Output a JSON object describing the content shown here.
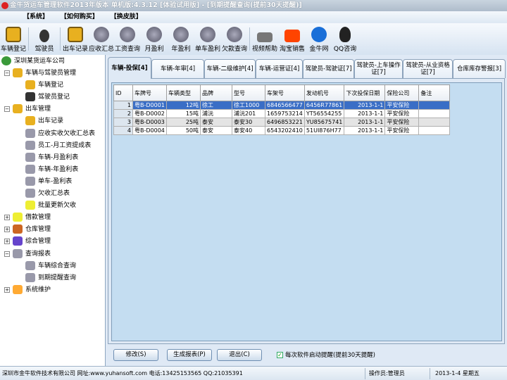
{
  "title": "金牛货运车管理软件2013年版本 单机版:4.3.12 [体验试用版] - [到期提醒查询(提前30天提醒)]",
  "menu": [
    "【系统】",
    "【如何购买】",
    "【换皮肤】"
  ],
  "toolbar": [
    "车辆登记",
    "驾驶员",
    "出车记录",
    "应收汇总",
    "工资查询",
    "月盈利",
    "年盈利",
    "单车盈利",
    "欠款查询",
    "视频帮助",
    "淘宝销售",
    "金牛网",
    "QQ咨询"
  ],
  "tree": {
    "root": "深圳某货运车公司",
    "items": [
      "车辆与驾驶员管理",
      "车辆登记",
      "驾驶员登记",
      "出车管理",
      "出车记录",
      "应收实收欠收汇总表",
      "员工-月工资提成表",
      "车辆-月盈利表",
      "车辆-年盈利表",
      "单车-盈利表",
      "欠收汇总表",
      "批量更新欠收",
      "借款管理",
      "仓库管理",
      "综合管理",
      "查询报表",
      "车辆综合查询",
      "到期提醒查询",
      "系统维护"
    ]
  },
  "tabs": [
    "车辆-投保[4]",
    "车辆-年审[4]",
    "车辆-二级维护[4]",
    "车辆-运营证[4]",
    "驾驶员-驾驶证[7]",
    "驾驶员-上车操作证[7]",
    "驾驶员-从业资格证[7]",
    "仓库库存警报[3]"
  ],
  "grid": {
    "columns": [
      "ID",
      "车牌号",
      "车辆类型",
      "品牌",
      "型号",
      "车架号",
      "发动机号",
      "下次投保日期",
      "保险公司",
      "备注"
    ],
    "rows": [
      [
        "1",
        "粤B-D0001",
        "12吨",
        "徐工",
        "徐工1000",
        "6846566477",
        "6456R77861",
        "2013-1-1",
        "平安保险",
        ""
      ],
      [
        "2",
        "粤B-D0002",
        "15吨",
        "浦沅",
        "浦沅201",
        "1659753214",
        "YT56554255",
        "2013-1-1",
        "平安保险",
        ""
      ],
      [
        "3",
        "粤B-D0003",
        "25吨",
        "泰安",
        "泰安30",
        "6496853221",
        "YU85675741",
        "2013-1-1",
        "平安保险",
        ""
      ],
      [
        "4",
        "粤B-D0004",
        "50吨",
        "泰安",
        "泰安40",
        "6543202410",
        "51UI876H77",
        "2013-1-1",
        "平安保险",
        ""
      ]
    ]
  },
  "buttons": {
    "edit": "修改(S)",
    "report": "生成报表(P)",
    "exit": "退出(C)"
  },
  "reminder_label": "每次软件启动提醒(提前30天提醒)",
  "status": {
    "company": "深圳市金牛软件技术有限公司 网址:www.yuhansoft.com 电话:13425153565 QQ:21035391",
    "operator": "操作员:管理员",
    "date": "2013-1-4 星期五"
  }
}
